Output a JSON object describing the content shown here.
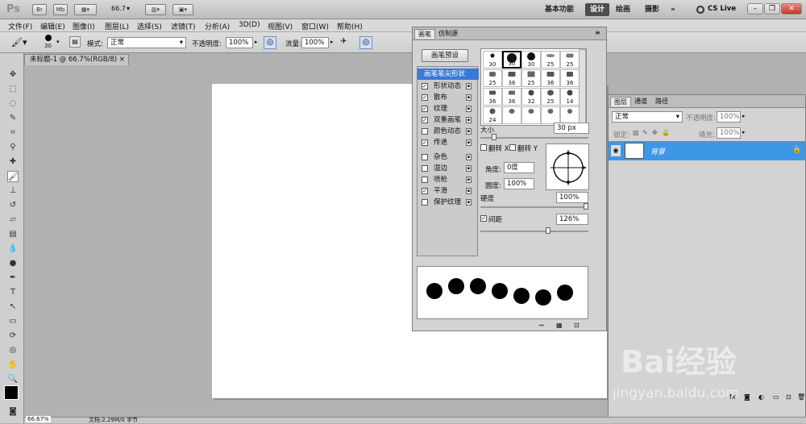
{
  "app": {
    "logo": "Ps",
    "br": "Br",
    "mb": "Mb",
    "zoom": "66.7"
  },
  "workspaces": {
    "basic": "基本功能",
    "design": "设计",
    "paint": "绘画",
    "photo": "摄影",
    "more": "»",
    "cslive": "CS Live"
  },
  "menu": [
    "文件(F)",
    "编辑(E)",
    "图像(I)",
    "图层(L)",
    "选择(S)",
    "滤镜(T)",
    "分析(A)",
    "3D(D)",
    "视图(V)",
    "窗口(W)",
    "帮助(H)"
  ],
  "options": {
    "brush_size": "30",
    "mode_label": "模式:",
    "mode_value": "正常",
    "opacity_label": "不透明度:",
    "opacity_value": "100%",
    "flow_label": "流量:",
    "flow_value": "100%"
  },
  "document": {
    "tab_title": "未标题-1 @ 66.7%(RGB/8)",
    "close": "×"
  },
  "brush_panel": {
    "tab_brush": "画笔",
    "tab_clone": "仿制源",
    "preset_button": "画笔预设",
    "options": [
      {
        "label": "画笔笔尖形状",
        "checked": null,
        "selected": true
      },
      {
        "label": "形状动态",
        "checked": true
      },
      {
        "label": "散布",
        "checked": true
      },
      {
        "label": "纹理",
        "checked": true
      },
      {
        "label": "双重画笔",
        "checked": true
      },
      {
        "label": "颜色动态",
        "checked": false
      },
      {
        "label": "传递",
        "checked": true
      },
      {
        "label": "杂色",
        "checked": false
      },
      {
        "label": "湿边",
        "checked": false
      },
      {
        "label": "喷枪",
        "checked": false
      },
      {
        "label": "平滑",
        "checked": true
      },
      {
        "label": "保护纹理",
        "checked": false
      }
    ],
    "brush_sizes": [
      "30",
      "30",
      "30",
      "25",
      "25",
      "25",
      "36",
      "25",
      "36",
      "36",
      "36",
      "36",
      "32",
      "25",
      "14",
      "24"
    ],
    "size_label": "大小",
    "size_value": "30 px",
    "flip_x": "翻转 X",
    "flip_y": "翻转 Y",
    "angle_label": "角度:",
    "angle_value": "0度",
    "roundness_label": "圆度:",
    "roundness_value": "100%",
    "hardness_label": "硬度",
    "hardness_value": "100%",
    "spacing_label": "间距",
    "spacing_value": "126%",
    "hardness_fraction": 1.0,
    "spacing_fraction": 0.63
  },
  "layers_panel": {
    "tab_layers": "图层",
    "tab_channels": "通道",
    "tab_paths": "路径",
    "blend_mode": "正常",
    "opacity_label": "不透明度:",
    "opacity_value": "100%",
    "lock_label": "锁定:",
    "fill_label": "填充:",
    "fill_value": "100%",
    "layer_name": "背景"
  },
  "status": {
    "zoom": "66.67%",
    "doc": "文档:2.29M/0 字节"
  },
  "watermark": {
    "brand": "Bai经验",
    "url": "jingyan.baidu.com"
  }
}
